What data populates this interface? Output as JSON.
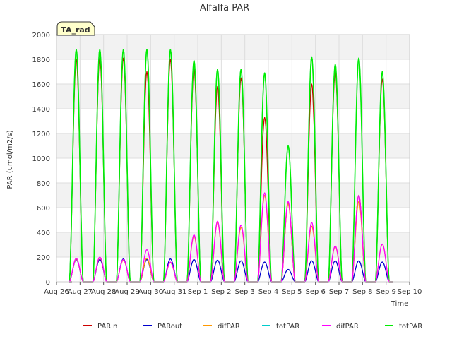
{
  "chart_data": {
    "type": "line",
    "title": "Alfalfa PAR",
    "xlabel": "Time",
    "ylabel": "PAR (umol/m2/s)",
    "ylim": [
      0,
      2000
    ],
    "xlim": [
      0,
      15
    ],
    "yticks": [
      0,
      200,
      400,
      600,
      800,
      1000,
      1200,
      1400,
      1600,
      1800,
      2000
    ],
    "xtick_labels": [
      "Aug 26",
      "Aug 27",
      "Aug 28",
      "Aug 29",
      "Aug 30",
      "Aug 31",
      "Sep 1",
      "Sep 2",
      "Sep 3",
      "Sep 4",
      "Sep 5",
      "Sep 6",
      "Sep 7",
      "Sep 8",
      "Sep 9",
      "Sep 10"
    ],
    "grid": true,
    "annotation": "TA_rad",
    "legend_position": "bottom",
    "series": [
      {
        "name": "PARin",
        "color": "#cc0000",
        "day_peaks": [
          1800,
          1810,
          1810,
          1700,
          1800,
          1720,
          1580,
          1650,
          1330,
          640,
          1600,
          1700,
          700,
          1640
        ]
      },
      {
        "name": "PARout",
        "color": "#0000cc",
        "day_peaks": [
          180,
          180,
          185,
          180,
          185,
          180,
          175,
          170,
          160,
          100,
          170,
          170,
          170,
          160
        ]
      },
      {
        "name": "difPAR",
        "color": "#ff9900",
        "day_peaks": [
          185,
          195,
          175,
          190,
          155,
          370,
          480,
          440,
          700,
          630,
          450,
          285,
          650,
          305
        ]
      },
      {
        "name": "totPAR",
        "color": "#00cccc",
        "day_peaks": [
          1880,
          1880,
          1880,
          1880,
          1880,
          1790,
          1720,
          1720,
          1690,
          1100,
          1820,
          1760,
          1810,
          1700
        ]
      },
      {
        "name": "difPAR",
        "color": "#ff00ff",
        "day_peaks": [
          190,
          200,
          180,
          260,
          160,
          380,
          490,
          460,
          720,
          650,
          480,
          290,
          700,
          305
        ]
      },
      {
        "name": "totPAR",
        "color": "#00ee00",
        "day_peaks": [
          1880,
          1880,
          1880,
          1880,
          1880,
          1790,
          1720,
          1720,
          1690,
          1100,
          1820,
          1760,
          1810,
          1700
        ]
      }
    ]
  }
}
